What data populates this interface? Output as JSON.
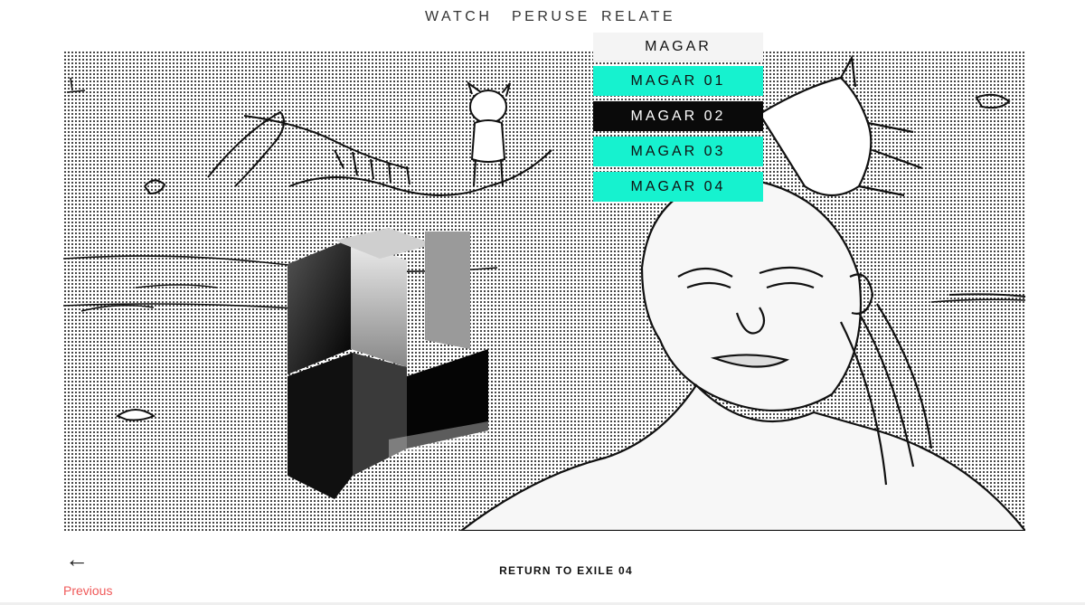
{
  "nav": {
    "items": [
      {
        "label": "WATCH"
      },
      {
        "label": "PERUSE"
      },
      {
        "label": "RELATE"
      }
    ]
  },
  "dropdown": {
    "header": "MAGAR",
    "items": [
      {
        "label": "MAGAR 01",
        "active": false
      },
      {
        "label": "MAGAR 02",
        "active": true
      },
      {
        "label": "MAGAR 03",
        "active": false
      },
      {
        "label": "MAGAR 04",
        "active": false
      }
    ],
    "colors": {
      "item_bg": "#16f2cf",
      "active_bg": "#0a0a0a",
      "active_text": "#ffffff"
    }
  },
  "footer": {
    "prev_arrow": "←",
    "prev_label": "Previous",
    "return_label": "RETURN TO EXILE 04",
    "prev_color": "#f05a5a"
  }
}
